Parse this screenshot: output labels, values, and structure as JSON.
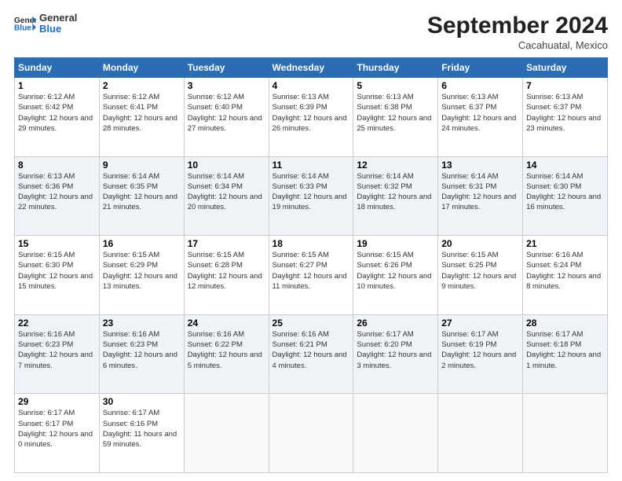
{
  "logo": {
    "line1": "General",
    "line2": "Blue"
  },
  "title": "September 2024",
  "location": "Cacahuatal, Mexico",
  "days_of_week": [
    "Sunday",
    "Monday",
    "Tuesday",
    "Wednesday",
    "Thursday",
    "Friday",
    "Saturday"
  ],
  "weeks": [
    [
      {
        "day": "1",
        "sunrise": "6:12 AM",
        "sunset": "6:42 PM",
        "daylight": "12 hours and 29 minutes."
      },
      {
        "day": "2",
        "sunrise": "6:12 AM",
        "sunset": "6:41 PM",
        "daylight": "12 hours and 28 minutes."
      },
      {
        "day": "3",
        "sunrise": "6:12 AM",
        "sunset": "6:40 PM",
        "daylight": "12 hours and 27 minutes."
      },
      {
        "day": "4",
        "sunrise": "6:13 AM",
        "sunset": "6:39 PM",
        "daylight": "12 hours and 26 minutes."
      },
      {
        "day": "5",
        "sunrise": "6:13 AM",
        "sunset": "6:38 PM",
        "daylight": "12 hours and 25 minutes."
      },
      {
        "day": "6",
        "sunrise": "6:13 AM",
        "sunset": "6:37 PM",
        "daylight": "12 hours and 24 minutes."
      },
      {
        "day": "7",
        "sunrise": "6:13 AM",
        "sunset": "6:37 PM",
        "daylight": "12 hours and 23 minutes."
      }
    ],
    [
      {
        "day": "8",
        "sunrise": "6:13 AM",
        "sunset": "6:36 PM",
        "daylight": "12 hours and 22 minutes."
      },
      {
        "day": "9",
        "sunrise": "6:14 AM",
        "sunset": "6:35 PM",
        "daylight": "12 hours and 21 minutes."
      },
      {
        "day": "10",
        "sunrise": "6:14 AM",
        "sunset": "6:34 PM",
        "daylight": "12 hours and 20 minutes."
      },
      {
        "day": "11",
        "sunrise": "6:14 AM",
        "sunset": "6:33 PM",
        "daylight": "12 hours and 19 minutes."
      },
      {
        "day": "12",
        "sunrise": "6:14 AM",
        "sunset": "6:32 PM",
        "daylight": "12 hours and 18 minutes."
      },
      {
        "day": "13",
        "sunrise": "6:14 AM",
        "sunset": "6:31 PM",
        "daylight": "12 hours and 17 minutes."
      },
      {
        "day": "14",
        "sunrise": "6:14 AM",
        "sunset": "6:30 PM",
        "daylight": "12 hours and 16 minutes."
      }
    ],
    [
      {
        "day": "15",
        "sunrise": "6:15 AM",
        "sunset": "6:30 PM",
        "daylight": "12 hours and 15 minutes."
      },
      {
        "day": "16",
        "sunrise": "6:15 AM",
        "sunset": "6:29 PM",
        "daylight": "12 hours and 13 minutes."
      },
      {
        "day": "17",
        "sunrise": "6:15 AM",
        "sunset": "6:28 PM",
        "daylight": "12 hours and 12 minutes."
      },
      {
        "day": "18",
        "sunrise": "6:15 AM",
        "sunset": "6:27 PM",
        "daylight": "12 hours and 11 minutes."
      },
      {
        "day": "19",
        "sunrise": "6:15 AM",
        "sunset": "6:26 PM",
        "daylight": "12 hours and 10 minutes."
      },
      {
        "day": "20",
        "sunrise": "6:15 AM",
        "sunset": "6:25 PM",
        "daylight": "12 hours and 9 minutes."
      },
      {
        "day": "21",
        "sunrise": "6:16 AM",
        "sunset": "6:24 PM",
        "daylight": "12 hours and 8 minutes."
      }
    ],
    [
      {
        "day": "22",
        "sunrise": "6:16 AM",
        "sunset": "6:23 PM",
        "daylight": "12 hours and 7 minutes."
      },
      {
        "day": "23",
        "sunrise": "6:16 AM",
        "sunset": "6:23 PM",
        "daylight": "12 hours and 6 minutes."
      },
      {
        "day": "24",
        "sunrise": "6:16 AM",
        "sunset": "6:22 PM",
        "daylight": "12 hours and 5 minutes."
      },
      {
        "day": "25",
        "sunrise": "6:16 AM",
        "sunset": "6:21 PM",
        "daylight": "12 hours and 4 minutes."
      },
      {
        "day": "26",
        "sunrise": "6:17 AM",
        "sunset": "6:20 PM",
        "daylight": "12 hours and 3 minutes."
      },
      {
        "day": "27",
        "sunrise": "6:17 AM",
        "sunset": "6:19 PM",
        "daylight": "12 hours and 2 minutes."
      },
      {
        "day": "28",
        "sunrise": "6:17 AM",
        "sunset": "6:18 PM",
        "daylight": "12 hours and 1 minute."
      }
    ],
    [
      {
        "day": "29",
        "sunrise": "6:17 AM",
        "sunset": "6:17 PM",
        "daylight": "12 hours and 0 minutes."
      },
      {
        "day": "30",
        "sunrise": "6:17 AM",
        "sunset": "6:16 PM",
        "daylight": "11 hours and 59 minutes."
      },
      null,
      null,
      null,
      null,
      null
    ]
  ],
  "labels": {
    "sunrise": "Sunrise:",
    "sunset": "Sunset:",
    "daylight": "Daylight:"
  }
}
